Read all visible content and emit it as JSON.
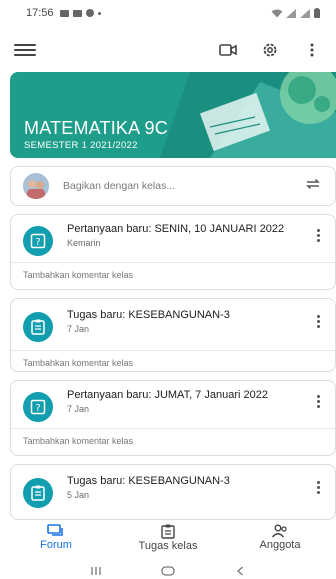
{
  "status_bar": {
    "time": "17:56"
  },
  "class": {
    "name": "MATEMATIKA 9C",
    "section": "SEMESTER 1 2021/2022"
  },
  "share": {
    "placeholder": "Bagikan dengan kelas..."
  },
  "stream": [
    {
      "type": "question",
      "icon": "question-icon",
      "title": "Pertanyaan baru: SENIN, 10 JANUARI 2022",
      "date": "Kemarin",
      "comment": "Tambahkan komentar kelas"
    },
    {
      "type": "assignment",
      "icon": "assignment-icon",
      "title": "Tugas baru: KESEBANGUNAN-3",
      "date": "7 Jan",
      "comment": "Tambahkan komentar kelas"
    },
    {
      "type": "question",
      "icon": "question-icon",
      "title": "Pertanyaan baru: JUMAT, 7 Januari 2022",
      "date": "7 Jan",
      "comment": "Tambahkan komentar kelas"
    },
    {
      "type": "assignment",
      "icon": "assignment-icon",
      "title": "Tugas baru: KESEBANGUNAN-3",
      "date": "5 Jan",
      "comment": ""
    }
  ],
  "bottom_nav": {
    "forum": "Forum",
    "classwork": "Tugas kelas",
    "people": "Anggota"
  },
  "colors": {
    "banner": "#1f9d8b",
    "item_icon": "#129eaf",
    "active": "#1a73e8"
  }
}
